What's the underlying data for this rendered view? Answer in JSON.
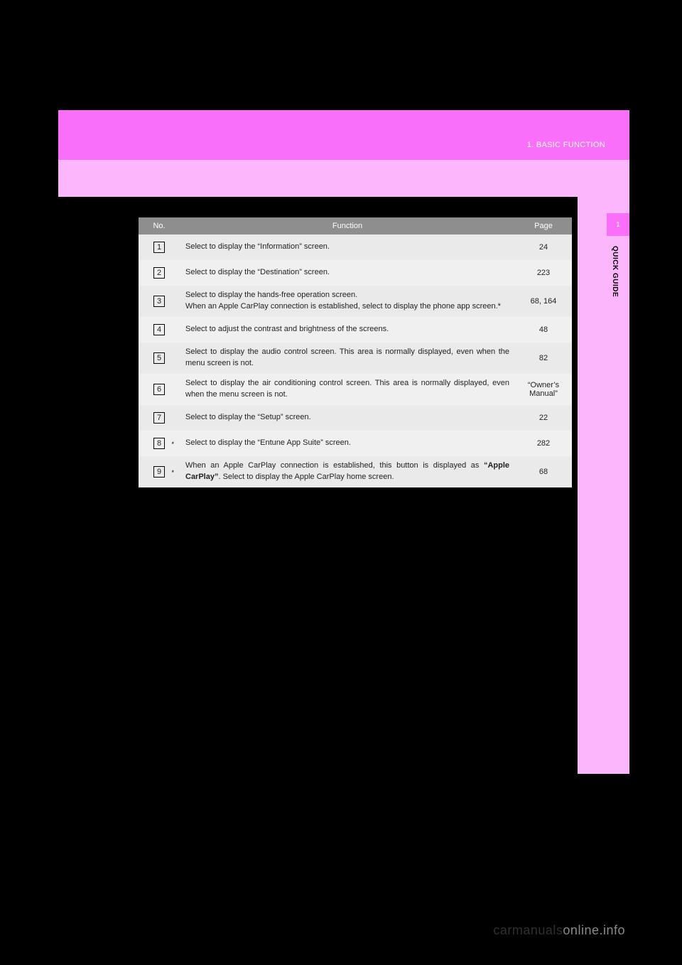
{
  "header": {
    "section_label": "1. BASIC FUNCTION",
    "tab_number": "1",
    "side_label": "QUICK GUIDE"
  },
  "table": {
    "headers": {
      "no": "No.",
      "function": "Function",
      "page": "Page"
    },
    "rows": [
      {
        "num": "1",
        "star": false,
        "function_plain": "Select to display the “Information” screen.",
        "page": "24"
      },
      {
        "num": "2",
        "star": false,
        "function_plain": "Select to display the “Destination” screen.",
        "page": "223"
      },
      {
        "num": "3",
        "star": false,
        "function_plain": "Select to display the hands-free operation screen.\nWhen an Apple CarPlay connection is established, select to display the phone app screen.*",
        "page": "68, 164"
      },
      {
        "num": "4",
        "star": false,
        "function_plain": "Select to adjust the contrast and brightness of the screens.",
        "page": "48"
      },
      {
        "num": "5",
        "star": false,
        "function_plain": "Select to display the audio control screen. This area is normally displayed, even when the menu screen is not.",
        "page": "82"
      },
      {
        "num": "6",
        "star": false,
        "function_plain": "Select to display the air conditioning control screen. This area is normally displayed, even when the menu screen is not.",
        "page": "“Owner’s Manual”"
      },
      {
        "num": "7",
        "star": false,
        "function_plain": "Select to display the “Setup” screen.",
        "page": "22"
      },
      {
        "num": "8",
        "star": true,
        "function_plain": "Select to display the “Entune App Suite” screen.",
        "page": "282"
      },
      {
        "num": "9",
        "star": true,
        "function_pre": "When an Apple CarPlay connection is established, this button is displayed as ",
        "function_bold": "“Apple CarPlay”",
        "function_post": ". Select to display the Apple CarPlay home screen.",
        "page": "68"
      }
    ]
  },
  "footer": {
    "watermark_main": "carmanuals",
    "watermark_light": "online.info"
  }
}
